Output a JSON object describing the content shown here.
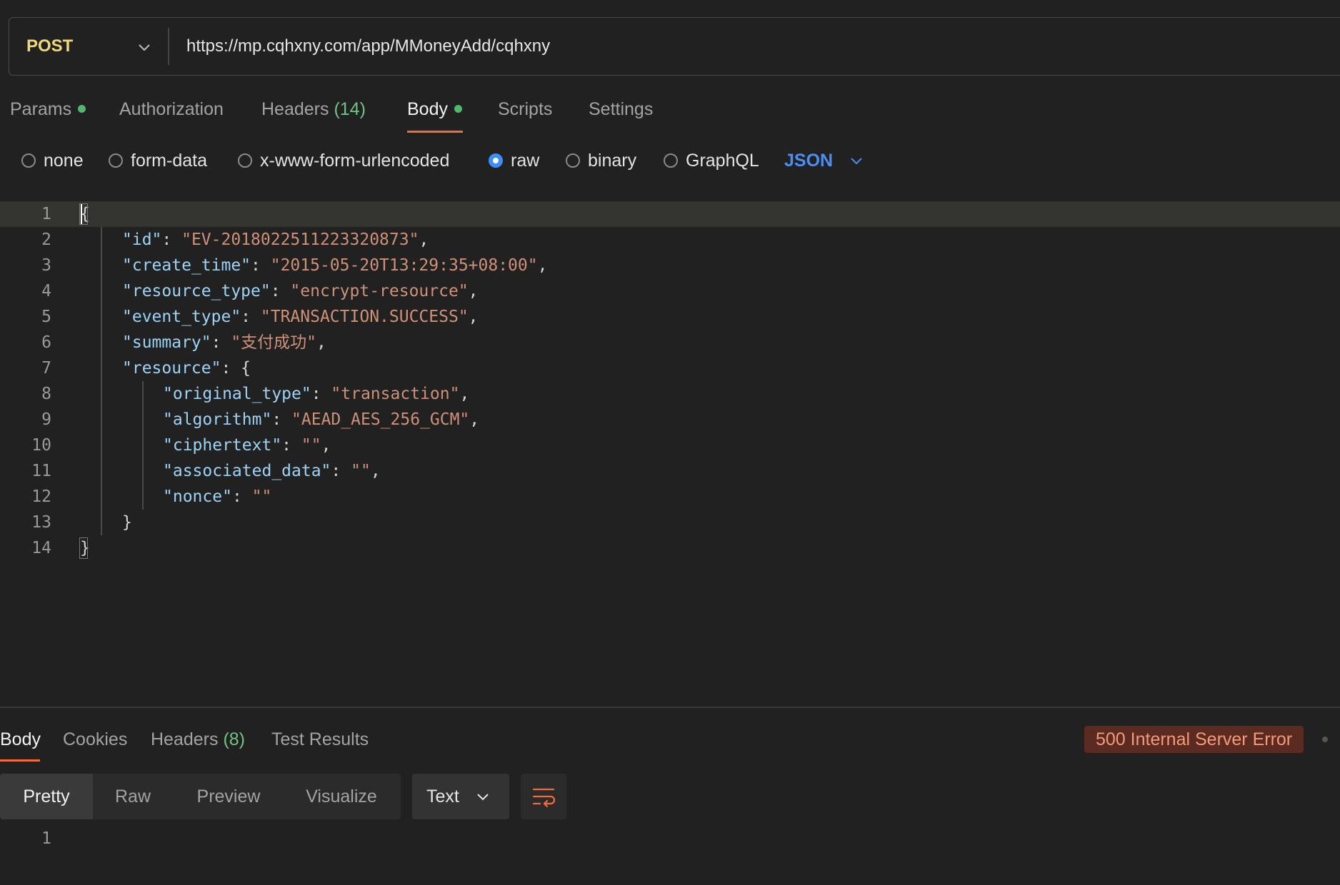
{
  "request": {
    "method": "POST",
    "url": "https://mp.cqhxny.com/app/MMoneyAdd/cqhxny"
  },
  "request_tabs": {
    "params": "Params",
    "authorization": "Authorization",
    "headers": "Headers",
    "headers_count": "(14)",
    "body": "Body",
    "scripts": "Scripts",
    "settings": "Settings"
  },
  "body_types": {
    "none": "none",
    "form_data": "form-data",
    "urlencoded": "x-www-form-urlencoded",
    "raw": "raw",
    "binary": "binary",
    "graphql": "GraphQL",
    "selected": "raw",
    "language": "JSON"
  },
  "editor": {
    "line_numbers": [
      "1",
      "2",
      "3",
      "4",
      "5",
      "6",
      "7",
      "8",
      "9",
      "10",
      "11",
      "12",
      "13",
      "14"
    ],
    "fields": {
      "id_key": "\"id\"",
      "id_val": "\"EV-2018022511223320873\"",
      "ct_key": "\"create_time\"",
      "ct_val": "\"2015-05-20T13:29:35+08:00\"",
      "rt_key": "\"resource_type\"",
      "rt_val": "\"encrypt-resource\"",
      "et_key": "\"event_type\"",
      "et_val": "\"TRANSACTION.SUCCESS\"",
      "sum_key": "\"summary\"",
      "sum_val": "\"支付成功\"",
      "res_key": "\"resource\"",
      "ot_key": "\"original_type\"",
      "ot_val": "\"transaction\"",
      "alg_key": "\"algorithm\"",
      "alg_val": "\"AEAD_AES_256_GCM\"",
      "ct2_key": "\"ciphertext\"",
      "ct2_val": "\"\"",
      "ad_key": "\"associated_data\"",
      "ad_val": "\"\"",
      "nonce_key": "\"nonce\"",
      "nonce_val": "\"\""
    }
  },
  "response_tabs": {
    "body": "Body",
    "cookies": "Cookies",
    "headers": "Headers",
    "headers_count": "(8)",
    "test_results": "Test Results"
  },
  "response": {
    "status": "500 Internal Server Error",
    "view_modes": [
      "Pretty",
      "Raw",
      "Preview",
      "Visualize"
    ],
    "format": "Text",
    "line_number": "1"
  },
  "colors": {
    "accent": "#f26b3a",
    "method": "#f0d873",
    "json_key": "#9cd3f5",
    "json_string": "#ce9178",
    "error_badge_bg": "#5b2a20",
    "error_badge_text": "#f39a7a"
  }
}
